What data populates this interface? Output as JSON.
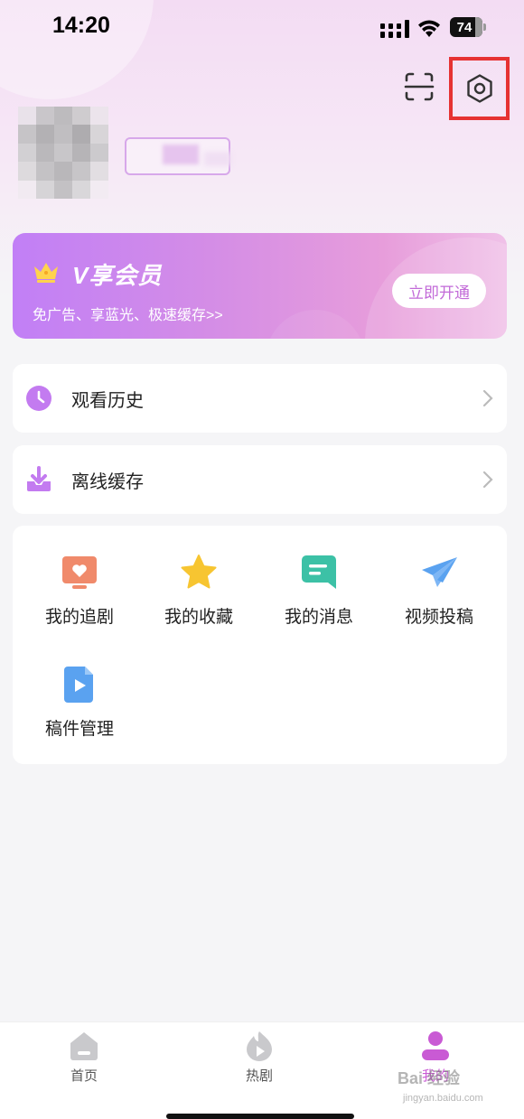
{
  "status_bar": {
    "time": "14:20",
    "battery": "74"
  },
  "header": {
    "scan_icon": "scan-icon",
    "settings_icon": "gear-icon",
    "highlight_color": "#e63232"
  },
  "vip": {
    "title": "V享会员",
    "subtitle": "免广告、享蓝光、极速缓存>>",
    "button": "立即开通"
  },
  "rows": [
    {
      "label": "观看历史",
      "icon": "clock-icon"
    },
    {
      "label": "离线缓存",
      "icon": "download-icon"
    }
  ],
  "grid": [
    {
      "label": "我的追剧",
      "icon": "tv-heart-icon",
      "color": "#f08a6b"
    },
    {
      "label": "我的收藏",
      "icon": "star-icon",
      "color": "#f7c531"
    },
    {
      "label": "我的消息",
      "icon": "message-icon",
      "color": "#3cc1a6"
    },
    {
      "label": "视频投稿",
      "icon": "paper-plane-icon",
      "color": "#5aa2f0"
    },
    {
      "label": "稿件管理",
      "icon": "video-file-icon",
      "color": "#5aa2f0"
    }
  ],
  "nav": [
    {
      "label": "首页",
      "icon": "home-icon"
    },
    {
      "label": "热剧",
      "icon": "flame-play-icon"
    },
    {
      "label": "我的",
      "icon": "user-icon"
    }
  ],
  "accent_color": "#c95ad4",
  "watermark": {
    "text": "Bai 经验",
    "sub": "jingyan.baidu.com"
  }
}
